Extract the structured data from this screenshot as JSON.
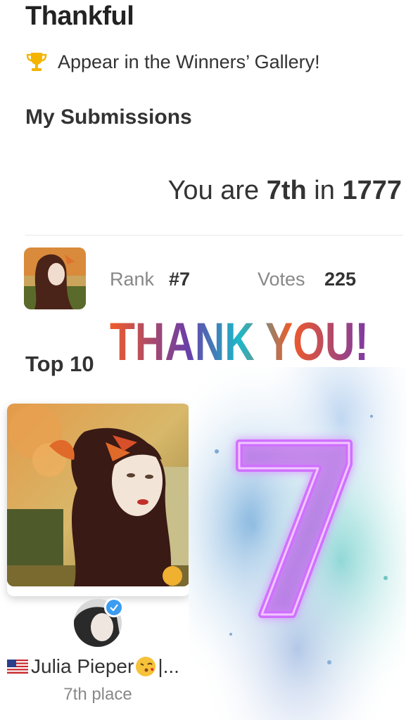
{
  "challenge": {
    "title": "Thankful",
    "gallery_text": "Appear in the Winners’ Gallery!"
  },
  "submissions": {
    "heading": "My Submissions",
    "summary_prefix": "You are ",
    "summary_rank": "7th",
    "summary_mid": " in ",
    "summary_total": "1777",
    "rank_label": "Rank",
    "rank_value": "#7",
    "votes_label": "Votes",
    "votes_value": "225"
  },
  "overlay": {
    "thank_you_text": "THANK YOU!",
    "big_number": "7"
  },
  "top10": {
    "heading": "Top 10",
    "entry": {
      "user_name": "Julia Pieper",
      "name_suffix": "|...",
      "place": "7th place"
    }
  },
  "colors": {
    "verified_badge": "#3b9cf0",
    "trophy": "#f4b400",
    "neon_seven": "#c23cf0"
  }
}
